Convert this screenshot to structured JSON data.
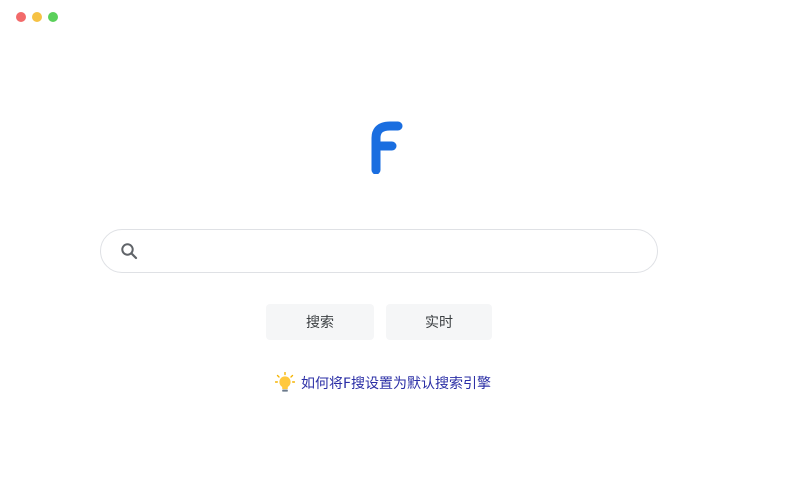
{
  "window": {
    "controls": [
      "close",
      "minimize",
      "zoom"
    ],
    "colors": {
      "close": "#f26a6a",
      "minimize": "#f6c244",
      "zoom": "#5ad05a"
    }
  },
  "logo": {
    "icon": "f-logo-icon",
    "color": "#1a6ee0"
  },
  "search": {
    "icon": "search-icon",
    "value": "",
    "placeholder": ""
  },
  "buttons": {
    "search_label": "搜索",
    "realtime_label": "实时"
  },
  "tip": {
    "icon": "lightbulb-icon",
    "text": "如何将F搜设置为默认搜索引擎",
    "color": "#2b2fa6"
  }
}
